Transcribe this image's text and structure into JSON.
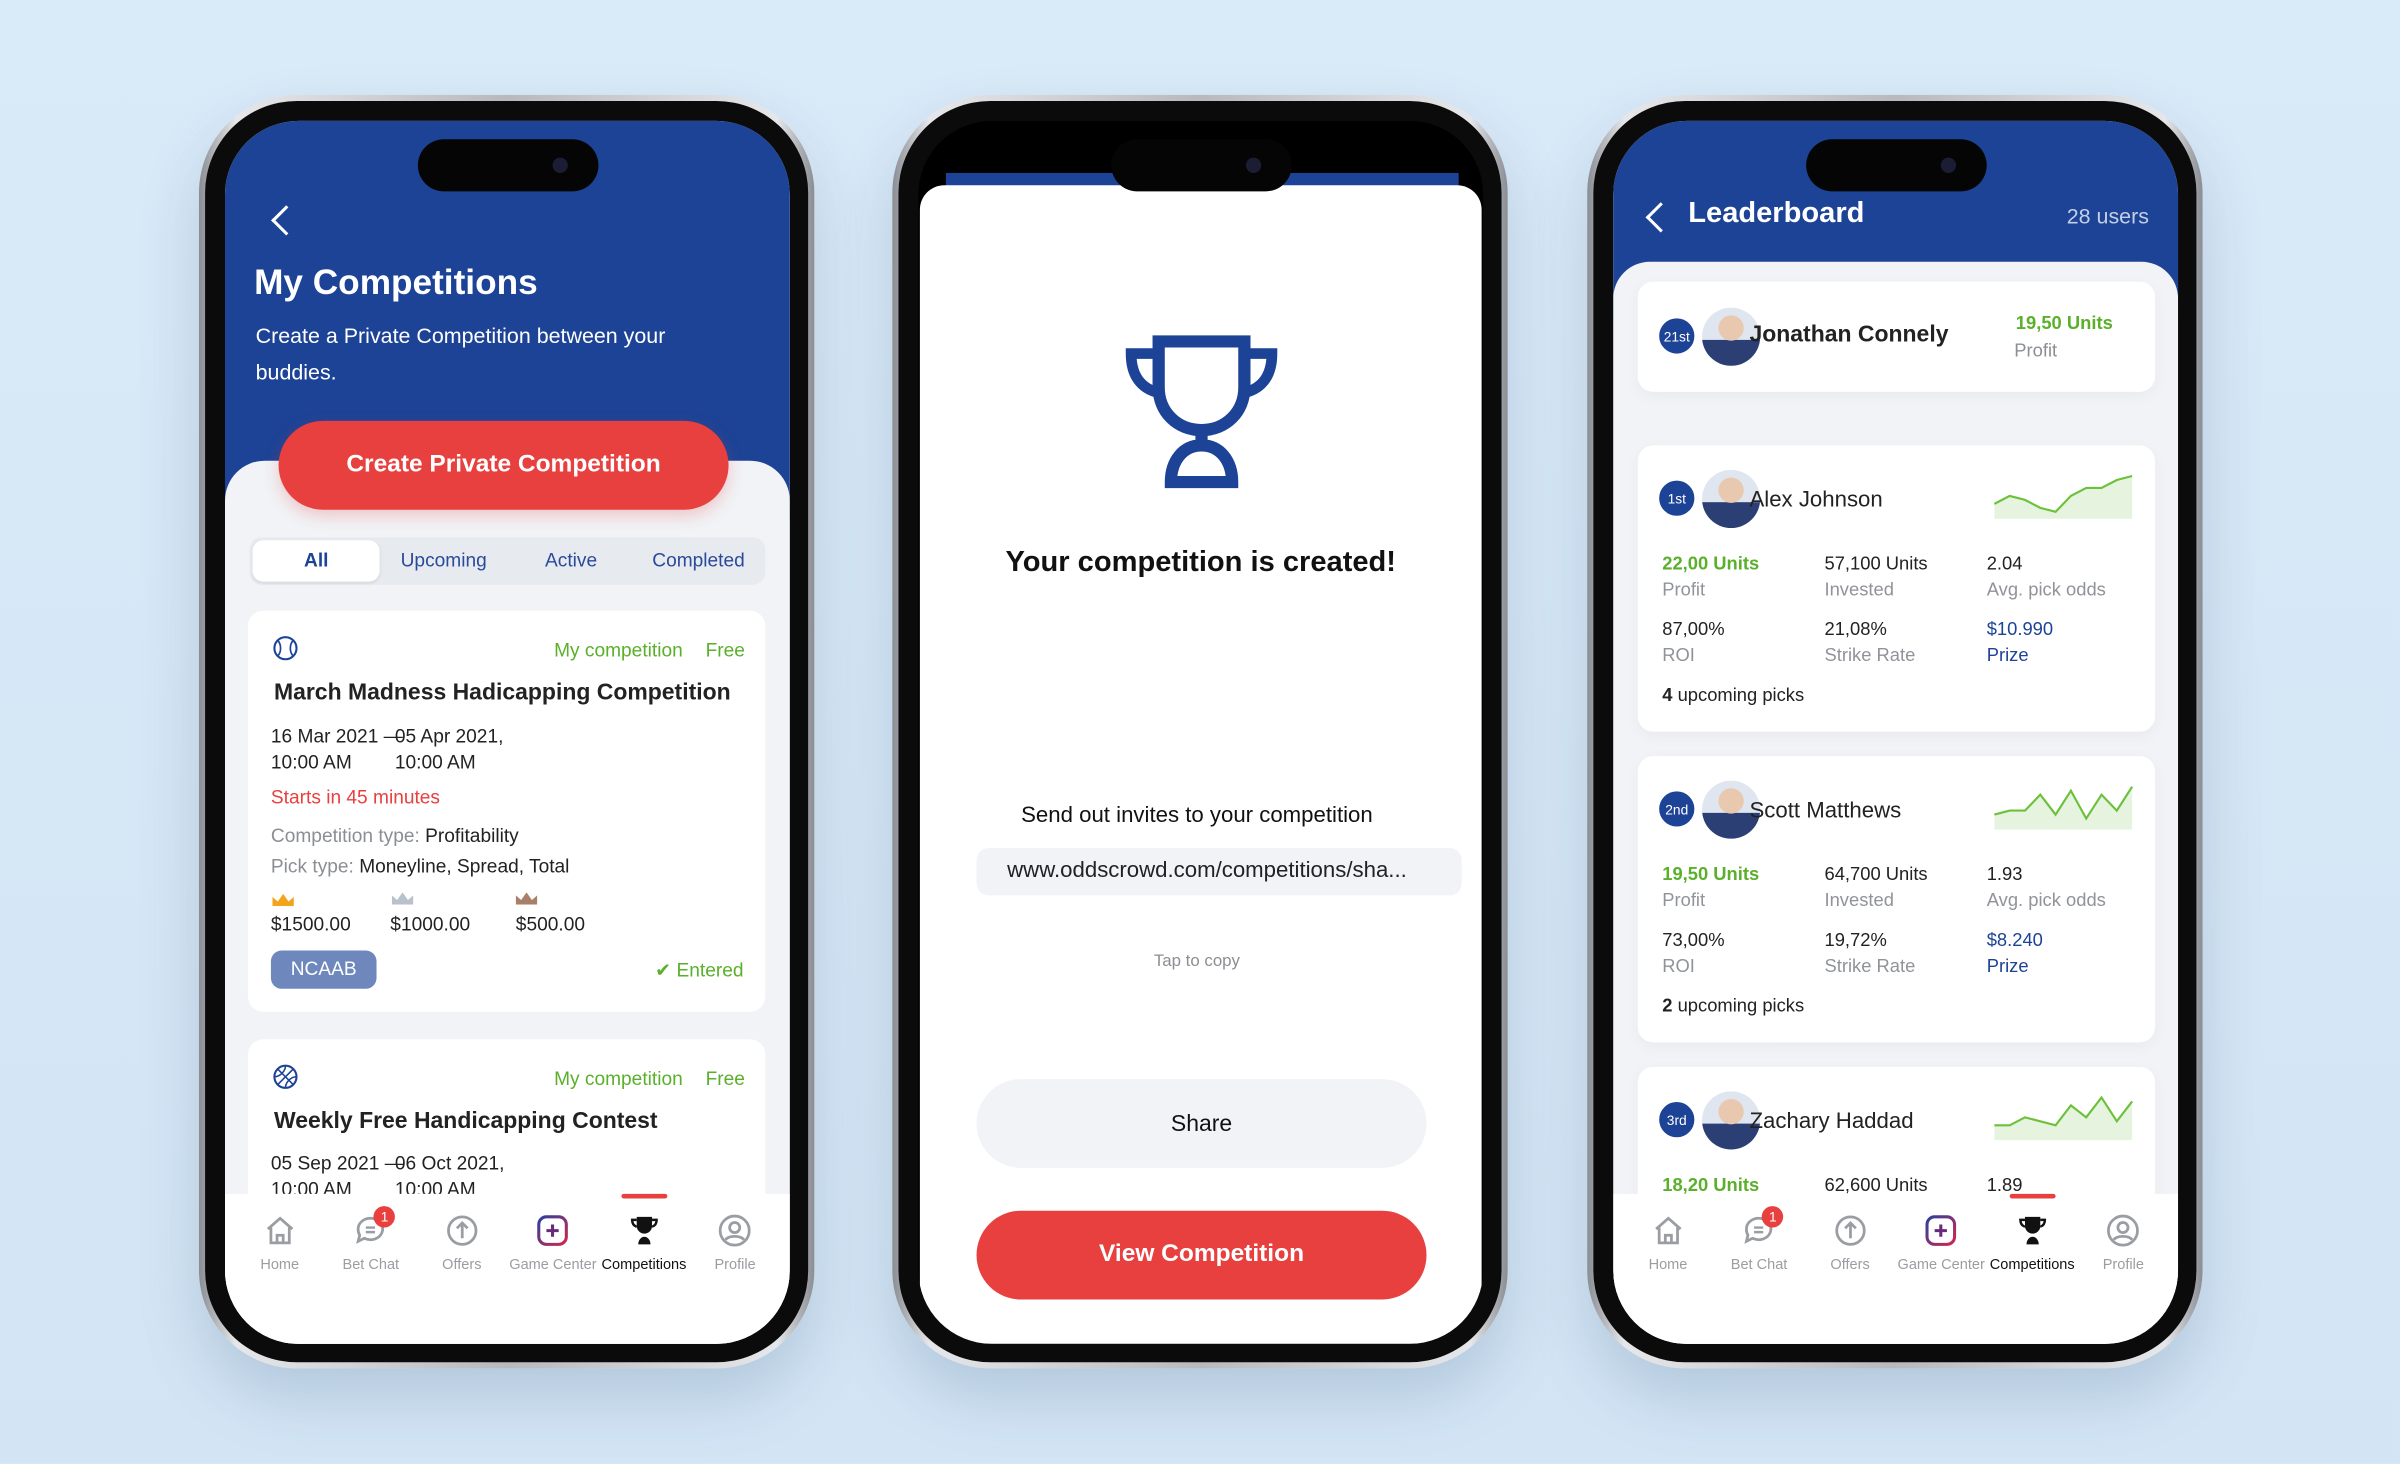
{
  "colors": {
    "brand_blue": "#1d4396",
    "accent_red": "#e8403f",
    "positive_green": "#5ab02b",
    "background": "#d6e8f7"
  },
  "nav": [
    {
      "label": "Home",
      "icon": "home-icon"
    },
    {
      "label": "Bet Chat",
      "icon": "chat-icon",
      "badge": "1"
    },
    {
      "label": "Offers",
      "icon": "offers-icon"
    },
    {
      "label": "Game Center",
      "icon": "game-center-icon"
    },
    {
      "label": "Competitions",
      "icon": "trophy-icon",
      "active": true
    },
    {
      "label": "Profile",
      "icon": "profile-icon"
    }
  ],
  "screen1": {
    "title": "My Competitions",
    "subtitle": "Create a Private Competition between your buddies.",
    "create_button": "Create Private Competition",
    "filters": [
      "All",
      "Upcoming",
      "Active",
      "Completed"
    ],
    "active_filter": "All",
    "competitions": [
      {
        "sport_icon": "baseball-icon",
        "owner": "My competition",
        "price": "Free",
        "title": "March Madness Hadicapping Competition",
        "start": "16 Mar 2021 —",
        "start_time": "10:00 AM",
        "end": "05 Apr 2021,",
        "end_time": "10:00 AM",
        "countdown": "Starts in 45 minutes",
        "type_label": "Competition type:",
        "type": "Profitability",
        "pick_label": "Pick type:",
        "pick": "Moneyline, Spread, Total",
        "prizes": [
          "$1500.00",
          "$1000.00",
          "$500.00"
        ],
        "league": "NCAAB",
        "status": "Entered"
      },
      {
        "sport_icon": "basketball-icon",
        "owner": "My competition",
        "price": "Free",
        "title": "Weekly Free Handicapping Contest",
        "start": "05 Sep 2021 —",
        "start_time": "10:00 AM",
        "end": "06 Oct 2021,",
        "end_time": "10:00 AM"
      }
    ]
  },
  "screen2": {
    "title": "Your competition is created!",
    "invite_label": "Send out invites to your competition",
    "url": "www.oddscrowd.com/competitions/sha...",
    "copy_hint": "Tap to copy",
    "share_button": "Share",
    "view_button": "View Competition"
  },
  "screen3": {
    "title": "Leaderboard",
    "user_count": "28 users",
    "me": {
      "rank": "21st",
      "name": "Jonathan Connely",
      "profit": "19,50 Units",
      "profit_label": "Profit"
    },
    "entries": [
      {
        "rank": "1st",
        "name": "Alex Johnson",
        "trend": [
          3,
          5,
          4,
          2,
          1,
          5,
          7,
          7,
          9,
          10
        ],
        "profit": "22,00 Units",
        "profit_label": "Profit",
        "invested": "57,100 Units",
        "invested_label": "Invested",
        "odds": "2.04",
        "odds_label": "Avg. pick odds",
        "roi": "87,00%",
        "roi_label": "ROI",
        "strike": "21,08%",
        "strike_label": "Strike Rate",
        "prize": "$10.990",
        "prize_label": "Prize",
        "upcoming_count": "4",
        "upcoming_label": "upcoming picks"
      },
      {
        "rank": "2nd",
        "name": "Scott Matthews",
        "trend": [
          3,
          4,
          4,
          8,
          3,
          9,
          2,
          8,
          4,
          10
        ],
        "profit": "19,50 Units",
        "profit_label": "Profit",
        "invested": "64,700 Units",
        "invested_label": "Invested",
        "odds": "1.93",
        "odds_label": "Avg. pick odds",
        "roi": "73,00%",
        "roi_label": "ROI",
        "strike": "19,72%",
        "strike_label": "Strike Rate",
        "prize": "$8.240",
        "prize_label": "Prize",
        "upcoming_count": "2",
        "upcoming_label": "upcoming picks"
      },
      {
        "rank": "3rd",
        "name": "Zachary Haddad",
        "trend": [
          3,
          3,
          5,
          4,
          3,
          8,
          5,
          10,
          4,
          9
        ],
        "profit": "18,20 Units",
        "invested": "62,600 Units",
        "odds": "1.89"
      }
    ]
  }
}
